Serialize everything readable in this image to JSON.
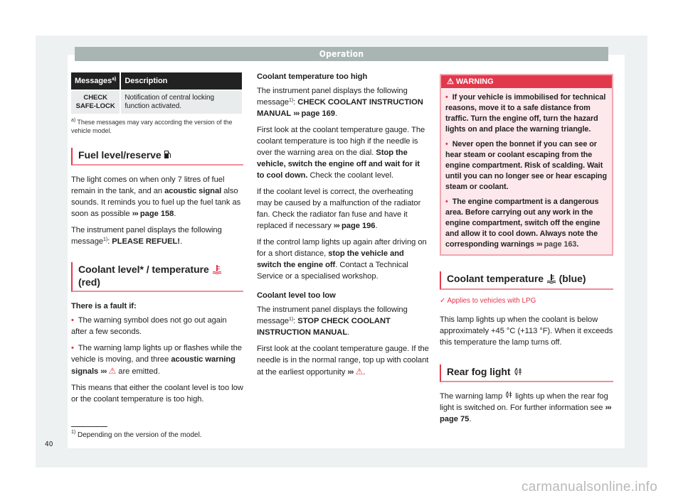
{
  "header": {
    "title": "Operation"
  },
  "table": {
    "headers": [
      "Messages",
      "Description"
    ],
    "header_sup": "a)",
    "rows": [
      {
        "message": "CHECK SAFE-LOCK",
        "description": "Notification of central locking function activated."
      }
    ],
    "footnote_mark": "a)",
    "footnote": "These messages may vary according the version of the vehicle model."
  },
  "fuel": {
    "heading": "Fuel level/reserve",
    "icon": "fuel-pump-icon",
    "p1_a": "The light comes on when only 7 litres of fuel remain in the tank, and an ",
    "p1_bold": "acoustic signal",
    "p1_b": " also sounds. It reminds you to fuel up the fuel tank as soon as possible ",
    "p1_link": "page 158",
    "p2_a": "The instrument panel displays the following message",
    "p2_sup": "1)",
    "p2_bold": "PLEASE REFUEL!"
  },
  "coolant_red": {
    "heading": "Coolant level* / temperature",
    "heading_suffix": "(red)",
    "icon": "coolant-temperature-icon",
    "icon_color": "#e2384c",
    "fault_heading": "There is a fault if:",
    "bullets": [
      "The warning symbol does not go out again after a few seconds.",
      "The warning lamp lights up or flashes while the vehicle is moving, and three "
    ],
    "bullet2_bold": "acoustic warning signals",
    "bullet2_end": " are emitted.",
    "summary": "This means that either the coolant level is too low or the coolant temperature is too high."
  },
  "too_high": {
    "heading": "Coolant temperature too high",
    "p1_a": "The instrument panel displays the following message",
    "p1_sup": "1)",
    "p1_bold": "CHECK COOLANT INSTRUCTION MANUAL",
    "p1_link": "page 169",
    "p2_a": "First look at the coolant temperature gauge. The coolant temperature is too high if the needle is over the warning area on the dial. ",
    "p2_bold": "Stop the vehicle, switch the engine off and wait for it to cool down.",
    "p2_b": " Check the coolant level.",
    "p3_a": "If the coolant level is correct, the overheating may be caused by a malfunction of the radiator fan. Check the radiator fan fuse and have it replaced if necessary ",
    "p3_link": "page 196",
    "p4_a": "If the control lamp lights up again after driving on for a short distance, ",
    "p4_bold": "stop the vehicle and switch the engine off",
    "p4_b": ". Contact a Technical Service or a specialised workshop."
  },
  "too_low": {
    "heading": "Coolant level too low",
    "p1_a": "The instrument panel displays the following message",
    "p1_sup": "1)",
    "p1_bold": "STOP CHECK COOLANT INSTRUCTION MANUAL",
    "p2_a": "First look at the coolant temperature gauge. If the needle is in the normal range, top up with coolant at the earliest opportunity "
  },
  "warning": {
    "title": "WARNING",
    "items": [
      "If your vehicle is immobilised for technical reasons, move it to a safe distance from traffic. Turn the engine off, turn the hazard lights on and place the warning triangle.",
      "Never open the bonnet if you can see or hear steam or coolant escaping from the engine compartment. Risk of scalding. Wait until you can no longer see or hear escaping steam or coolant.",
      "The engine compartment is a dangerous area. Before carrying out any work in the engine compartment, switch off the engine and allow it to cool down. Always note the corresponding warnings "
    ],
    "item3_link": "page 163"
  },
  "coolant_blue": {
    "heading": "Coolant temperature",
    "heading_suffix": "(blue)",
    "icon": "coolant-temperature-icon",
    "applies": "Applies to vehicles with LPG",
    "body": "This lamp lights up when the coolant is below approximately +45 °C (+113 °F). When it exceeds this temperature the lamp turns off."
  },
  "fog": {
    "heading": "Rear fog light",
    "icon": "rear-fog-light-icon",
    "body_a": "The warning lamp ",
    "body_b": " lights up when the rear fog light is switched on. For further information see ",
    "body_link": "page 75"
  },
  "footnote": {
    "mark": "1)",
    "text": "Depending on the version of the model."
  },
  "page_number": "40",
  "watermark": "carmanualsonline.info",
  "symbols": {
    "arrows": "›››",
    "triangle": "⚠",
    "check": "✓",
    "bullet": "•"
  },
  "colors": {
    "accent": "#e2384c",
    "header_bar": "#a8b5b3",
    "warning_bg": "#fde8eb",
    "table_header": "#222222"
  }
}
